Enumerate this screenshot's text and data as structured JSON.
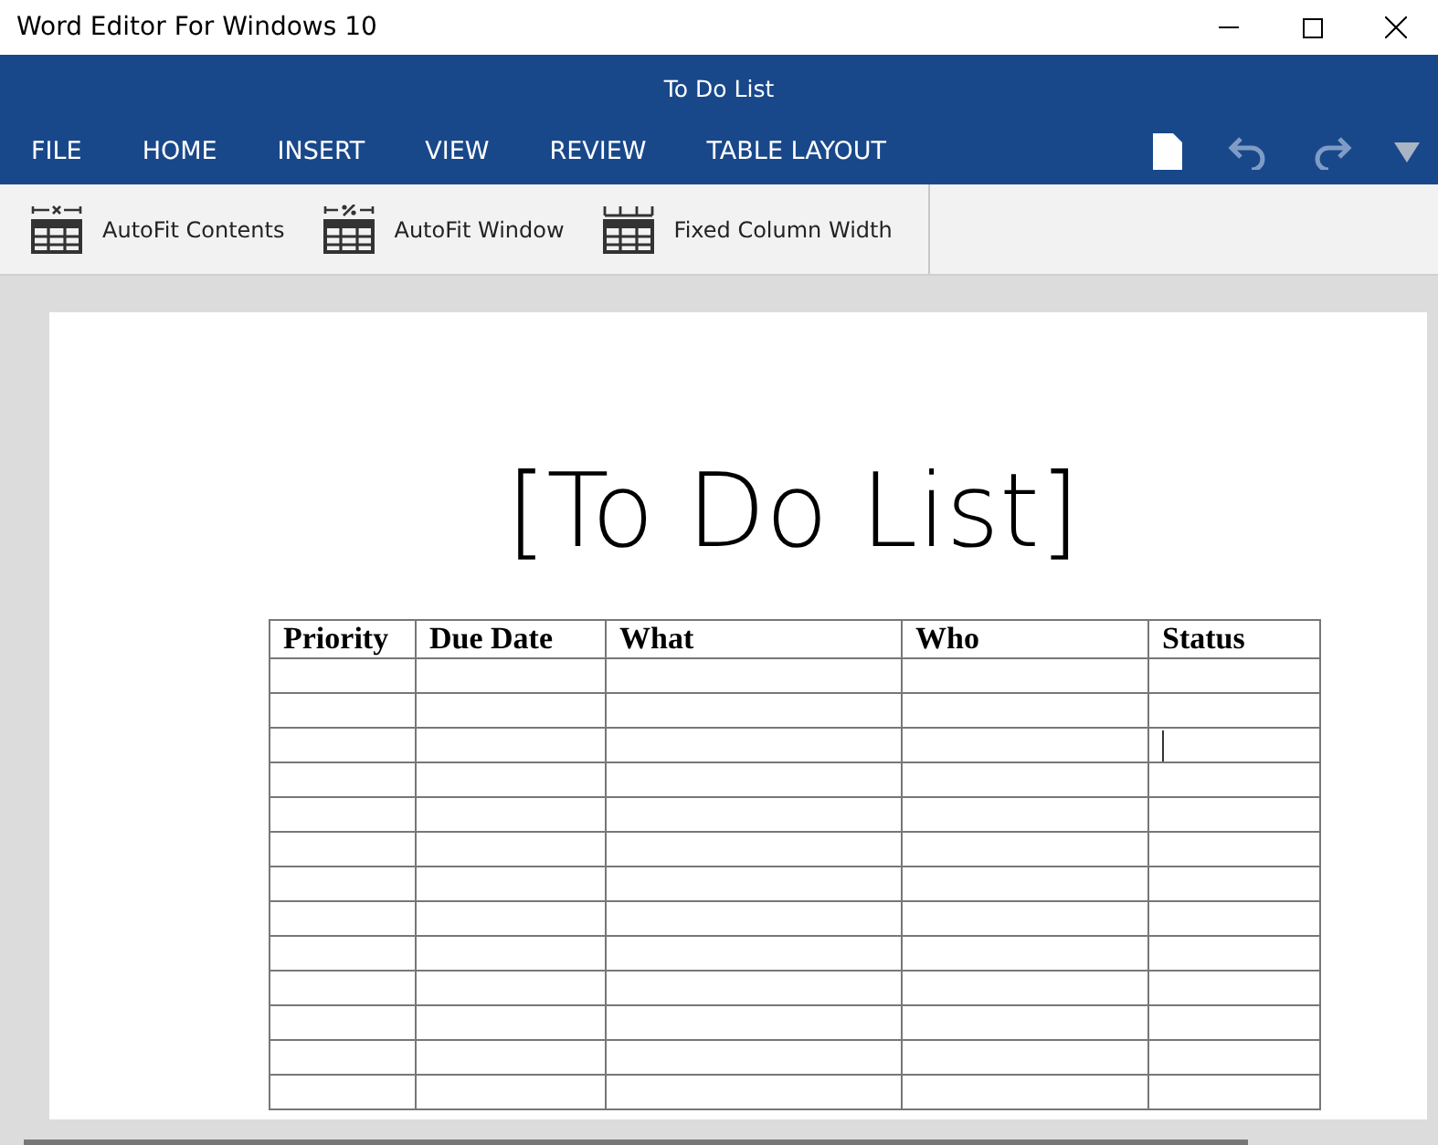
{
  "window": {
    "title": "Word Editor For Windows 10"
  },
  "document_title": "To Do List",
  "menu": [
    "FILE",
    "HOME",
    "INSERT",
    "VIEW",
    "REVIEW",
    "TABLE LAYOUT"
  ],
  "ribbon": [
    {
      "kind": "autofit-contents",
      "label": "AutoFit Contents"
    },
    {
      "kind": "autofit-window",
      "label": "AutoFit Window"
    },
    {
      "kind": "fixed-width",
      "label": "Fixed Column Width"
    }
  ],
  "document": {
    "heading": "[To Do List]",
    "table": {
      "columns": [
        "Priority",
        "Due Date",
        "What",
        "Who",
        "Status"
      ]
    }
  }
}
